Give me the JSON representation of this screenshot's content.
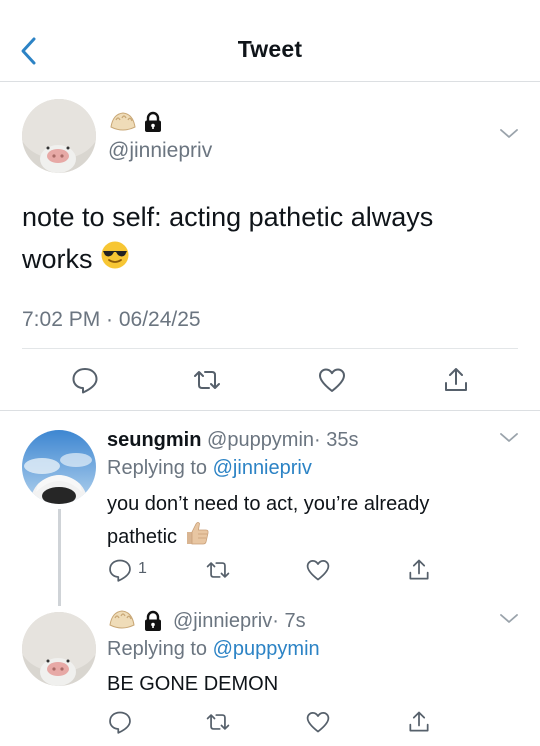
{
  "header": {
    "title": "Tweet",
    "back_icon": "chevron-left-icon",
    "accent": "#2c83c5"
  },
  "main_tweet": {
    "handle": "@jinniepriv",
    "name_icons": [
      "dumpling-emoji-icon",
      "lock-icon"
    ],
    "text_line1": "note to self: acting pathetic always",
    "text_line2": "works",
    "text_emoji": "sunglasses-emoji-icon",
    "meta": "7:02 PM · 06/24/25",
    "actions": [
      "reply-icon",
      "retweet-icon",
      "like-icon",
      "share-icon"
    ]
  },
  "replies": [
    {
      "name": "seungmin",
      "handle": "@puppymin",
      "time": "· 35s",
      "replying_prefix": "Replying to",
      "replying_to": "@jinniepriv",
      "text_line1": "you don’t need to act, you’re already",
      "text_line2": "pathetic",
      "text_emoji": "thumbs-up-emoji-icon",
      "reply_count": "1"
    },
    {
      "handle": "@jinniepriv",
      "time": "· 7s",
      "name_icons": [
        "dumpling-emoji-icon",
        "lock-icon"
      ],
      "replying_prefix": "Replying to",
      "replying_to": "@puppymin",
      "text": "BE GONE DEMON"
    }
  ],
  "colors": {
    "text": "#0f1419",
    "muted": "#6b7580",
    "link": "#2c83c5",
    "divider": "#dcdfe2"
  }
}
